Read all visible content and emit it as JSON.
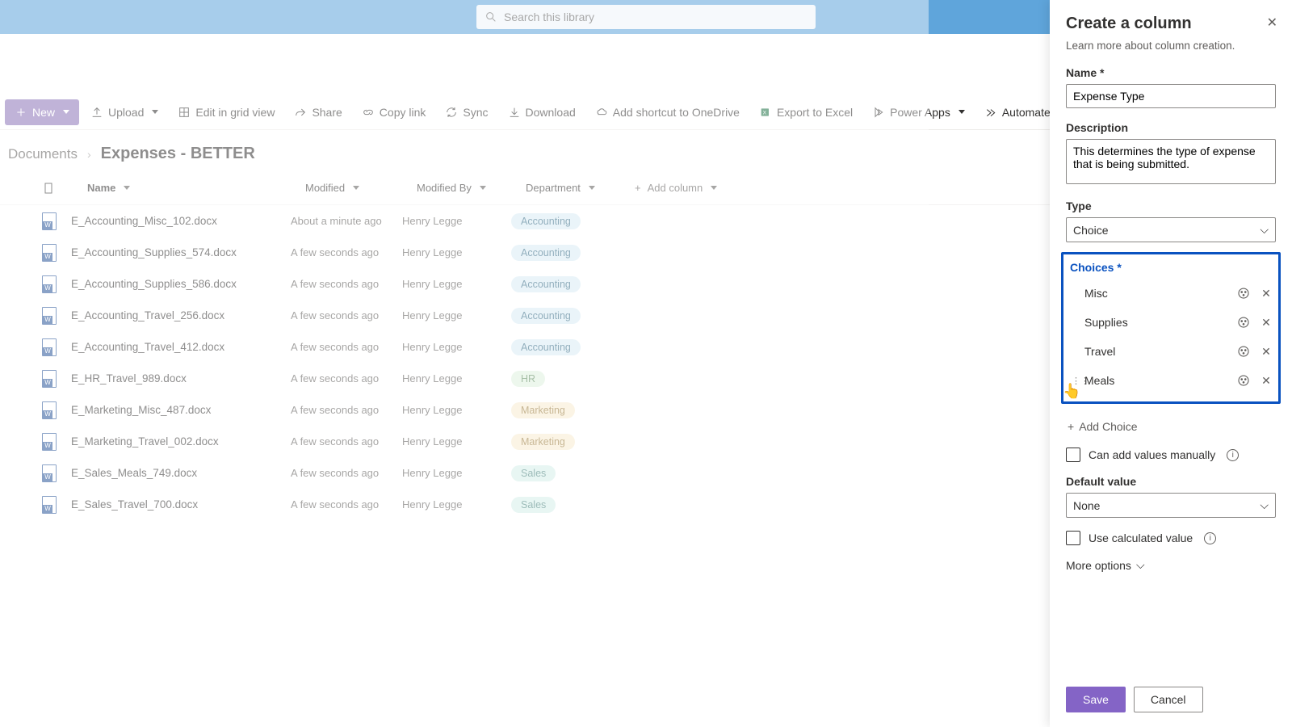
{
  "search": {
    "placeholder": "Search this library"
  },
  "toolbar": {
    "new": "New",
    "upload": "Upload",
    "edit_grid": "Edit in grid view",
    "share": "Share",
    "copy_link": "Copy link",
    "sync": "Sync",
    "download": "Download",
    "shortcut": "Add shortcut to OneDrive",
    "export": "Export to Excel",
    "power_apps": "Power Apps",
    "automate": "Automate"
  },
  "breadcrumb": {
    "root": "Documents",
    "current": "Expenses - BETTER"
  },
  "columns": {
    "name": "Name",
    "modified": "Modified",
    "modified_by": "Modified By",
    "department": "Department",
    "add": "Add column"
  },
  "rows": [
    {
      "name": "E_Accounting_Misc_102.docx",
      "modified": "About a minute ago",
      "by": "Henry Legge",
      "dept": "Accounting",
      "pill": "p-acct"
    },
    {
      "name": "E_Accounting_Supplies_574.docx",
      "modified": "A few seconds ago",
      "by": "Henry Legge",
      "dept": "Accounting",
      "pill": "p-acct"
    },
    {
      "name": "E_Accounting_Supplies_586.docx",
      "modified": "A few seconds ago",
      "by": "Henry Legge",
      "dept": "Accounting",
      "pill": "p-acct"
    },
    {
      "name": "E_Accounting_Travel_256.docx",
      "modified": "A few seconds ago",
      "by": "Henry Legge",
      "dept": "Accounting",
      "pill": "p-acct"
    },
    {
      "name": "E_Accounting_Travel_412.docx",
      "modified": "A few seconds ago",
      "by": "Henry Legge",
      "dept": "Accounting",
      "pill": "p-acct"
    },
    {
      "name": "E_HR_Travel_989.docx",
      "modified": "A few seconds ago",
      "by": "Henry Legge",
      "dept": "HR",
      "pill": "p-hr"
    },
    {
      "name": "E_Marketing_Misc_487.docx",
      "modified": "A few seconds ago",
      "by": "Henry Legge",
      "dept": "Marketing",
      "pill": "p-mkt"
    },
    {
      "name": "E_Marketing_Travel_002.docx",
      "modified": "A few seconds ago",
      "by": "Henry Legge",
      "dept": "Marketing",
      "pill": "p-mkt"
    },
    {
      "name": "E_Sales_Meals_749.docx",
      "modified": "A few seconds ago",
      "by": "Henry Legge",
      "dept": "Sales",
      "pill": "p-sales"
    },
    {
      "name": "E_Sales_Travel_700.docx",
      "modified": "A few seconds ago",
      "by": "Henry Legge",
      "dept": "Sales",
      "pill": "p-sales"
    }
  ],
  "panel": {
    "title": "Create a column",
    "subtitle": "Learn more about column creation.",
    "name_label": "Name *",
    "name_value": "Expense Type",
    "desc_label": "Description",
    "desc_value": "This determines the type of expense that is being submitted.",
    "type_label": "Type",
    "type_value": "Choice",
    "choices_label": "Choices *",
    "choices": [
      "Misc",
      "Supplies",
      "Travel",
      "Meals"
    ],
    "add_choice": "Add Choice",
    "can_add_manual": "Can add values manually",
    "default_label": "Default value",
    "default_value": "None",
    "use_calc": "Use calculated value",
    "more_options": "More options",
    "save": "Save",
    "cancel": "Cancel"
  }
}
